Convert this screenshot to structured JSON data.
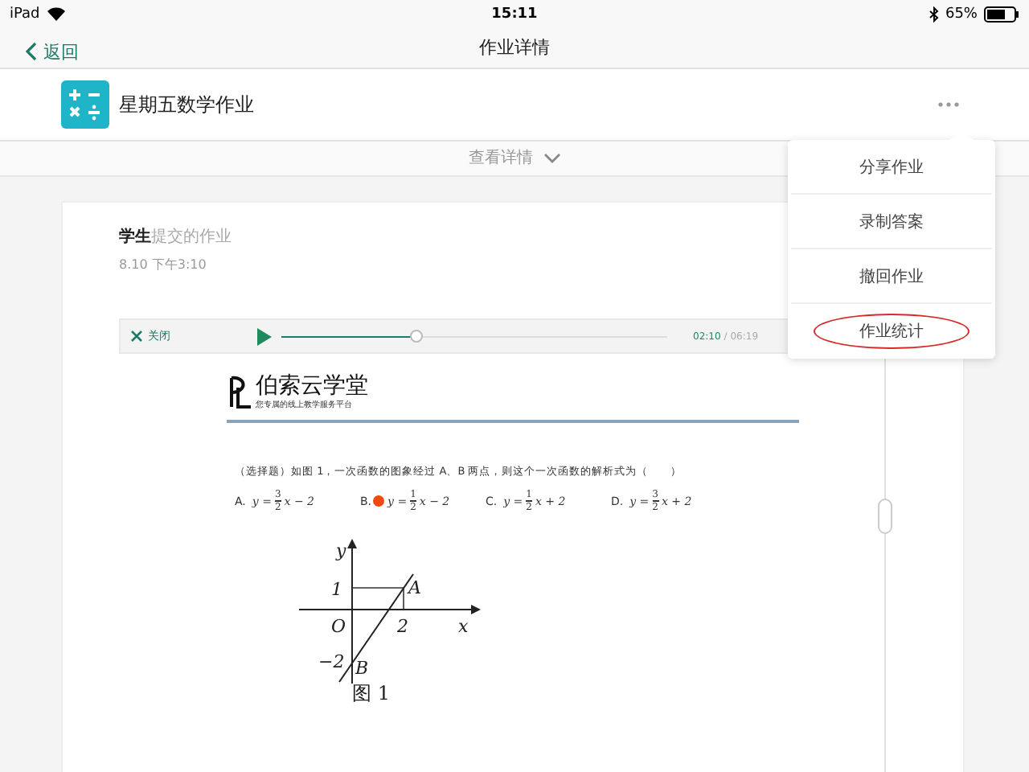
{
  "status_bar": {
    "device": "iPad",
    "time": "15:11",
    "battery": "65%"
  },
  "nav": {
    "back": "返回",
    "title": "作业详情"
  },
  "homework": {
    "title": "星期五数学作业"
  },
  "details_toggle": {
    "label": "查看详情",
    "expanded": false
  },
  "menu": {
    "items": [
      {
        "label": "分享作业",
        "circled": false
      },
      {
        "label": "录制答案",
        "circled": false
      },
      {
        "label": "撤回作业",
        "circled": false
      },
      {
        "label": "作业统计",
        "circled": true
      }
    ]
  },
  "submission": {
    "title": "**学生**提交的作业",
    "date": "8.10 下午3:10"
  },
  "player": {
    "close": "关闭",
    "playing": false,
    "level": 0.35,
    "elapsed": "02:10",
    "total": "/ 06:19"
  },
  "document": {
    "brand": "伯索云学堂",
    "slogan": "您专属的线上教学服务平台",
    "question": "（选择题）如图 1，一次函数的图象经过 A、B 两点，则这个一次函数的解析式为（　　）",
    "options": [
      {
        "letter": "A.",
        "lhs": "y =",
        "numerator": "3",
        "denominator": "2",
        "rest": "x − 2",
        "marked": false
      },
      {
        "letter": "B.",
        "lhs": "y =",
        "numerator": "1",
        "denominator": "2",
        "rest": "x − 2",
        "marked": true
      },
      {
        "letter": "C.",
        "lhs": "y =",
        "numerator": "1",
        "denominator": "2",
        "rest": "x + 2",
        "marked": false
      },
      {
        "letter": "D.",
        "lhs": "y =",
        "numerator": "3",
        "denominator": "2",
        "rest": "x + 2",
        "marked": false
      }
    ],
    "figure": {
      "y_axis": "y",
      "x_axis": "x",
      "origin": "O",
      "one": "1",
      "two": "2",
      "minus_two": "−2",
      "point_a": "A",
      "point_b": "B",
      "caption": "图 1"
    }
  }
}
